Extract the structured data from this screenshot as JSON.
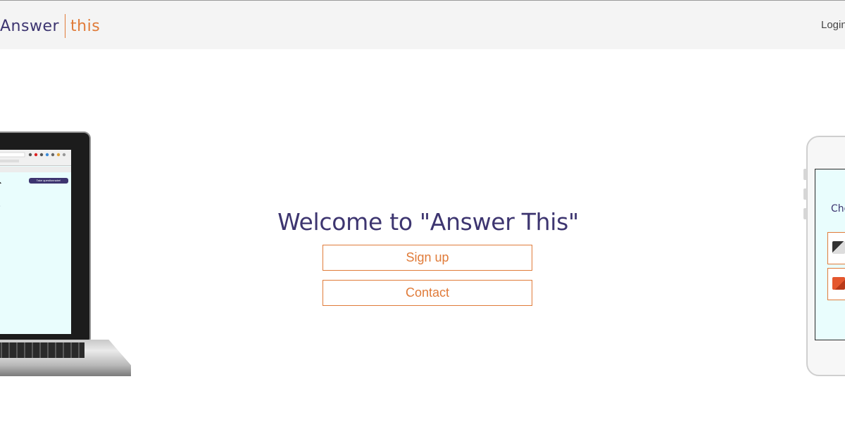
{
  "navbar": {
    "brand_left": "Answer",
    "brand_right": "this",
    "login_label": "Login"
  },
  "hero": {
    "title": "Welcome to \"Answer This\"",
    "signup_label": "Sign up",
    "contact_label": "Contact"
  },
  "illustrations": {
    "laptop_screen_button": "Take questionnaire!",
    "laptop_screen_text": "ge",
    "phone_screen_text": "Cho"
  },
  "colors": {
    "primary": "#3d3570",
    "accent": "#e07b39",
    "navbar_bg": "#f4f4f4",
    "screen_bg": "#e9fdfd"
  }
}
